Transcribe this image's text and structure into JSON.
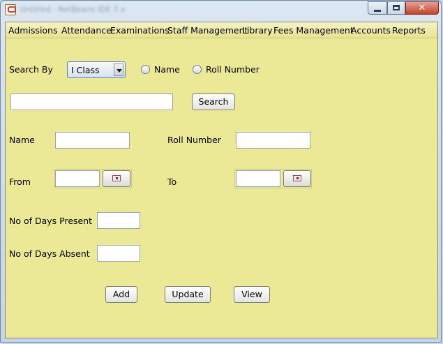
{
  "window": {
    "title": "Untitled - NetBeans IDE 7.x"
  },
  "menu": {
    "items": [
      "Admissions",
      "Attendance",
      "Examinations",
      "Staff Management",
      "Library",
      "Fees Management",
      "Accounts",
      "Reports"
    ]
  },
  "form": {
    "search_by_label": "Search By",
    "search_by_selected": "I Class",
    "radio_name_label": "Name",
    "radio_roll_label": "Roll Number",
    "search_input_value": "",
    "search_button": "Search",
    "name_label": "Name",
    "name_value": "",
    "roll_label": "Roll Number",
    "roll_value": "",
    "from_label": "From",
    "from_value": "",
    "to_label": "To",
    "to_value": "",
    "present_label": "No of Days Present",
    "present_value": "",
    "absent_label": "No of Days Absent",
    "absent_value": "",
    "add_button": "Add",
    "update_button": "Update",
    "view_button": "View"
  },
  "colors": {
    "panel_background": "#ebe996",
    "menubar_background": "#e6e48e",
    "close_button": "#c5422b"
  },
  "icons": [
    "java-app-icon",
    "minimize-icon",
    "maximize-icon",
    "close-icon",
    "calendar-icon",
    "dropdown-arrow-icon"
  ]
}
